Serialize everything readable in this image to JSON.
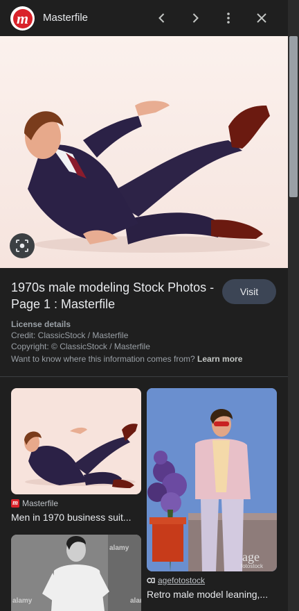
{
  "header": {
    "site_name": "Masterfile",
    "logo_letter": "m"
  },
  "result": {
    "title": "1970s male modeling Stock Photos - Page 1 : Masterfile",
    "visit_label": "Visit",
    "license_heading": "License details",
    "credit": "Credit: ClassicStock / Masterfile",
    "copyright": "Copyright: © ClassicStock / Masterfile",
    "info_question": "Want to know where this information comes from?",
    "learn_more": "Learn more"
  },
  "related": [
    {
      "source": "Masterfile",
      "title": "Men in 1970 business suit..."
    },
    {
      "source": "agefotostock",
      "title": "Retro male model leaning,..."
    },
    {
      "watermark": "alamy"
    }
  ],
  "watermarks": {
    "age": "age",
    "age_sub": "fotostock"
  },
  "colors": {
    "background": "#1f1f1f",
    "accent_red": "#d9222a",
    "visit_button": "#3c4555",
    "muted_text": "#9aa0a6"
  }
}
